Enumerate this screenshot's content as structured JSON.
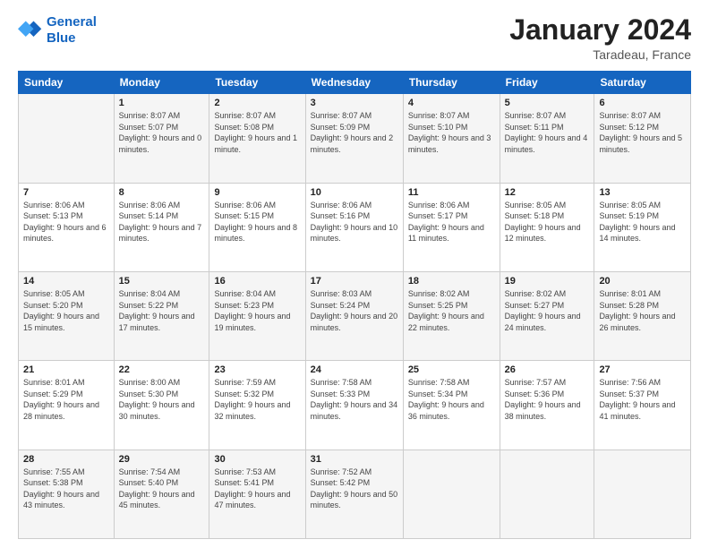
{
  "header": {
    "logo_line1": "General",
    "logo_line2": "Blue",
    "month": "January 2024",
    "location": "Taradeau, France"
  },
  "weekdays": [
    "Sunday",
    "Monday",
    "Tuesday",
    "Wednesday",
    "Thursday",
    "Friday",
    "Saturday"
  ],
  "weeks": [
    [
      {
        "day": "",
        "sunrise": "",
        "sunset": "",
        "daylight": ""
      },
      {
        "day": "1",
        "sunrise": "Sunrise: 8:07 AM",
        "sunset": "Sunset: 5:07 PM",
        "daylight": "Daylight: 9 hours and 0 minutes."
      },
      {
        "day": "2",
        "sunrise": "Sunrise: 8:07 AM",
        "sunset": "Sunset: 5:08 PM",
        "daylight": "Daylight: 9 hours and 1 minute."
      },
      {
        "day": "3",
        "sunrise": "Sunrise: 8:07 AM",
        "sunset": "Sunset: 5:09 PM",
        "daylight": "Daylight: 9 hours and 2 minutes."
      },
      {
        "day": "4",
        "sunrise": "Sunrise: 8:07 AM",
        "sunset": "Sunset: 5:10 PM",
        "daylight": "Daylight: 9 hours and 3 minutes."
      },
      {
        "day": "5",
        "sunrise": "Sunrise: 8:07 AM",
        "sunset": "Sunset: 5:11 PM",
        "daylight": "Daylight: 9 hours and 4 minutes."
      },
      {
        "day": "6",
        "sunrise": "Sunrise: 8:07 AM",
        "sunset": "Sunset: 5:12 PM",
        "daylight": "Daylight: 9 hours and 5 minutes."
      }
    ],
    [
      {
        "day": "7",
        "sunrise": "Sunrise: 8:06 AM",
        "sunset": "Sunset: 5:13 PM",
        "daylight": "Daylight: 9 hours and 6 minutes."
      },
      {
        "day": "8",
        "sunrise": "Sunrise: 8:06 AM",
        "sunset": "Sunset: 5:14 PM",
        "daylight": "Daylight: 9 hours and 7 minutes."
      },
      {
        "day": "9",
        "sunrise": "Sunrise: 8:06 AM",
        "sunset": "Sunset: 5:15 PM",
        "daylight": "Daylight: 9 hours and 8 minutes."
      },
      {
        "day": "10",
        "sunrise": "Sunrise: 8:06 AM",
        "sunset": "Sunset: 5:16 PM",
        "daylight": "Daylight: 9 hours and 10 minutes."
      },
      {
        "day": "11",
        "sunrise": "Sunrise: 8:06 AM",
        "sunset": "Sunset: 5:17 PM",
        "daylight": "Daylight: 9 hours and 11 minutes."
      },
      {
        "day": "12",
        "sunrise": "Sunrise: 8:05 AM",
        "sunset": "Sunset: 5:18 PM",
        "daylight": "Daylight: 9 hours and 12 minutes."
      },
      {
        "day": "13",
        "sunrise": "Sunrise: 8:05 AM",
        "sunset": "Sunset: 5:19 PM",
        "daylight": "Daylight: 9 hours and 14 minutes."
      }
    ],
    [
      {
        "day": "14",
        "sunrise": "Sunrise: 8:05 AM",
        "sunset": "Sunset: 5:20 PM",
        "daylight": "Daylight: 9 hours and 15 minutes."
      },
      {
        "day": "15",
        "sunrise": "Sunrise: 8:04 AM",
        "sunset": "Sunset: 5:22 PM",
        "daylight": "Daylight: 9 hours and 17 minutes."
      },
      {
        "day": "16",
        "sunrise": "Sunrise: 8:04 AM",
        "sunset": "Sunset: 5:23 PM",
        "daylight": "Daylight: 9 hours and 19 minutes."
      },
      {
        "day": "17",
        "sunrise": "Sunrise: 8:03 AM",
        "sunset": "Sunset: 5:24 PM",
        "daylight": "Daylight: 9 hours and 20 minutes."
      },
      {
        "day": "18",
        "sunrise": "Sunrise: 8:02 AM",
        "sunset": "Sunset: 5:25 PM",
        "daylight": "Daylight: 9 hours and 22 minutes."
      },
      {
        "day": "19",
        "sunrise": "Sunrise: 8:02 AM",
        "sunset": "Sunset: 5:27 PM",
        "daylight": "Daylight: 9 hours and 24 minutes."
      },
      {
        "day": "20",
        "sunrise": "Sunrise: 8:01 AM",
        "sunset": "Sunset: 5:28 PM",
        "daylight": "Daylight: 9 hours and 26 minutes."
      }
    ],
    [
      {
        "day": "21",
        "sunrise": "Sunrise: 8:01 AM",
        "sunset": "Sunset: 5:29 PM",
        "daylight": "Daylight: 9 hours and 28 minutes."
      },
      {
        "day": "22",
        "sunrise": "Sunrise: 8:00 AM",
        "sunset": "Sunset: 5:30 PM",
        "daylight": "Daylight: 9 hours and 30 minutes."
      },
      {
        "day": "23",
        "sunrise": "Sunrise: 7:59 AM",
        "sunset": "Sunset: 5:32 PM",
        "daylight": "Daylight: 9 hours and 32 minutes."
      },
      {
        "day": "24",
        "sunrise": "Sunrise: 7:58 AM",
        "sunset": "Sunset: 5:33 PM",
        "daylight": "Daylight: 9 hours and 34 minutes."
      },
      {
        "day": "25",
        "sunrise": "Sunrise: 7:58 AM",
        "sunset": "Sunset: 5:34 PM",
        "daylight": "Daylight: 9 hours and 36 minutes."
      },
      {
        "day": "26",
        "sunrise": "Sunrise: 7:57 AM",
        "sunset": "Sunset: 5:36 PM",
        "daylight": "Daylight: 9 hours and 38 minutes."
      },
      {
        "day": "27",
        "sunrise": "Sunrise: 7:56 AM",
        "sunset": "Sunset: 5:37 PM",
        "daylight": "Daylight: 9 hours and 41 minutes."
      }
    ],
    [
      {
        "day": "28",
        "sunrise": "Sunrise: 7:55 AM",
        "sunset": "Sunset: 5:38 PM",
        "daylight": "Daylight: 9 hours and 43 minutes."
      },
      {
        "day": "29",
        "sunrise": "Sunrise: 7:54 AM",
        "sunset": "Sunset: 5:40 PM",
        "daylight": "Daylight: 9 hours and 45 minutes."
      },
      {
        "day": "30",
        "sunrise": "Sunrise: 7:53 AM",
        "sunset": "Sunset: 5:41 PM",
        "daylight": "Daylight: 9 hours and 47 minutes."
      },
      {
        "day": "31",
        "sunrise": "Sunrise: 7:52 AM",
        "sunset": "Sunset: 5:42 PM",
        "daylight": "Daylight: 9 hours and 50 minutes."
      },
      {
        "day": "",
        "sunrise": "",
        "sunset": "",
        "daylight": ""
      },
      {
        "day": "",
        "sunrise": "",
        "sunset": "",
        "daylight": ""
      },
      {
        "day": "",
        "sunrise": "",
        "sunset": "",
        "daylight": ""
      }
    ]
  ]
}
